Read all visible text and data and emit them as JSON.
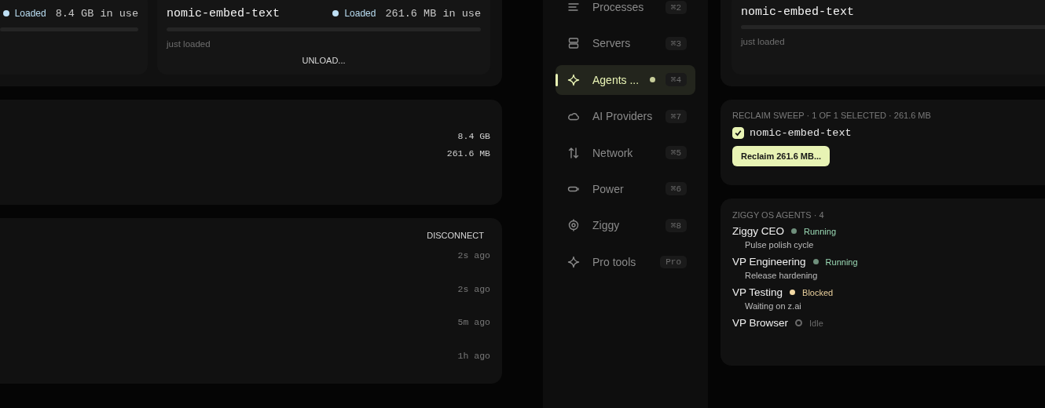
{
  "models_panel": {
    "cards": [
      {
        "status": "Loaded",
        "usage": "8.4 GB in use"
      },
      {
        "name": "nomic-embed-text",
        "status": "Loaded",
        "usage": "261.6 MB in use",
        "note": "just loaded",
        "action": "UNLOAD..."
      }
    ]
  },
  "memory_panel": {
    "values": [
      "8.4 GB",
      "261.6 MB"
    ]
  },
  "connections_panel": {
    "action": "DISCONNECT",
    "times": [
      "2s ago",
      "2s ago",
      "5m ago",
      "1h ago"
    ]
  },
  "sidebar": {
    "items": [
      {
        "label": "Processes",
        "shortcut": "⌘2",
        "selected": false,
        "activity": false
      },
      {
        "label": "Servers",
        "shortcut": "⌘3",
        "selected": false,
        "activity": false
      },
      {
        "label": "Agents ...",
        "shortcut": "⌘4",
        "selected": true,
        "activity": true
      },
      {
        "label": "AI Providers",
        "shortcut": "⌘7",
        "selected": false,
        "activity": false
      },
      {
        "label": "Network",
        "shortcut": "⌘5",
        "selected": false,
        "activity": false
      },
      {
        "label": "Power",
        "shortcut": "⌘6",
        "selected": false,
        "activity": false
      },
      {
        "label": "Ziggy",
        "shortcut": "⌘8",
        "selected": false,
        "activity": false
      },
      {
        "label": "Pro tools",
        "shortcut": "Pro",
        "selected": false,
        "activity": false
      }
    ]
  },
  "detail_model": {
    "name": "nomic-embed-text",
    "note": "just loaded"
  },
  "reclaim": {
    "title": "RECLAIM SWEEP · 1 OF 1 SELECTED · 261.6 MB",
    "items": [
      {
        "name": "nomic-embed-text",
        "checked": true
      }
    ],
    "button": "Reclaim 261.6 MB..."
  },
  "agents": {
    "title": "ZIGGY OS AGENTS · 4",
    "items": [
      {
        "name": "Ziggy CEO",
        "kind": "filled",
        "color": "#6f8f7c",
        "status": "Running",
        "task": "Pulse polish cycle"
      },
      {
        "name": "VP Engineering",
        "kind": "filled",
        "color": "#6f8f7c",
        "status": "Running",
        "task": "Release hardening"
      },
      {
        "name": "VP Testing",
        "kind": "filled",
        "color": "#f3d9a4",
        "status": "Blocked",
        "task": "Waiting on z.ai"
      },
      {
        "name": "VP Browser",
        "kind": "hollow",
        "color": "#6a6a6a",
        "status": "Idle"
      }
    ]
  }
}
